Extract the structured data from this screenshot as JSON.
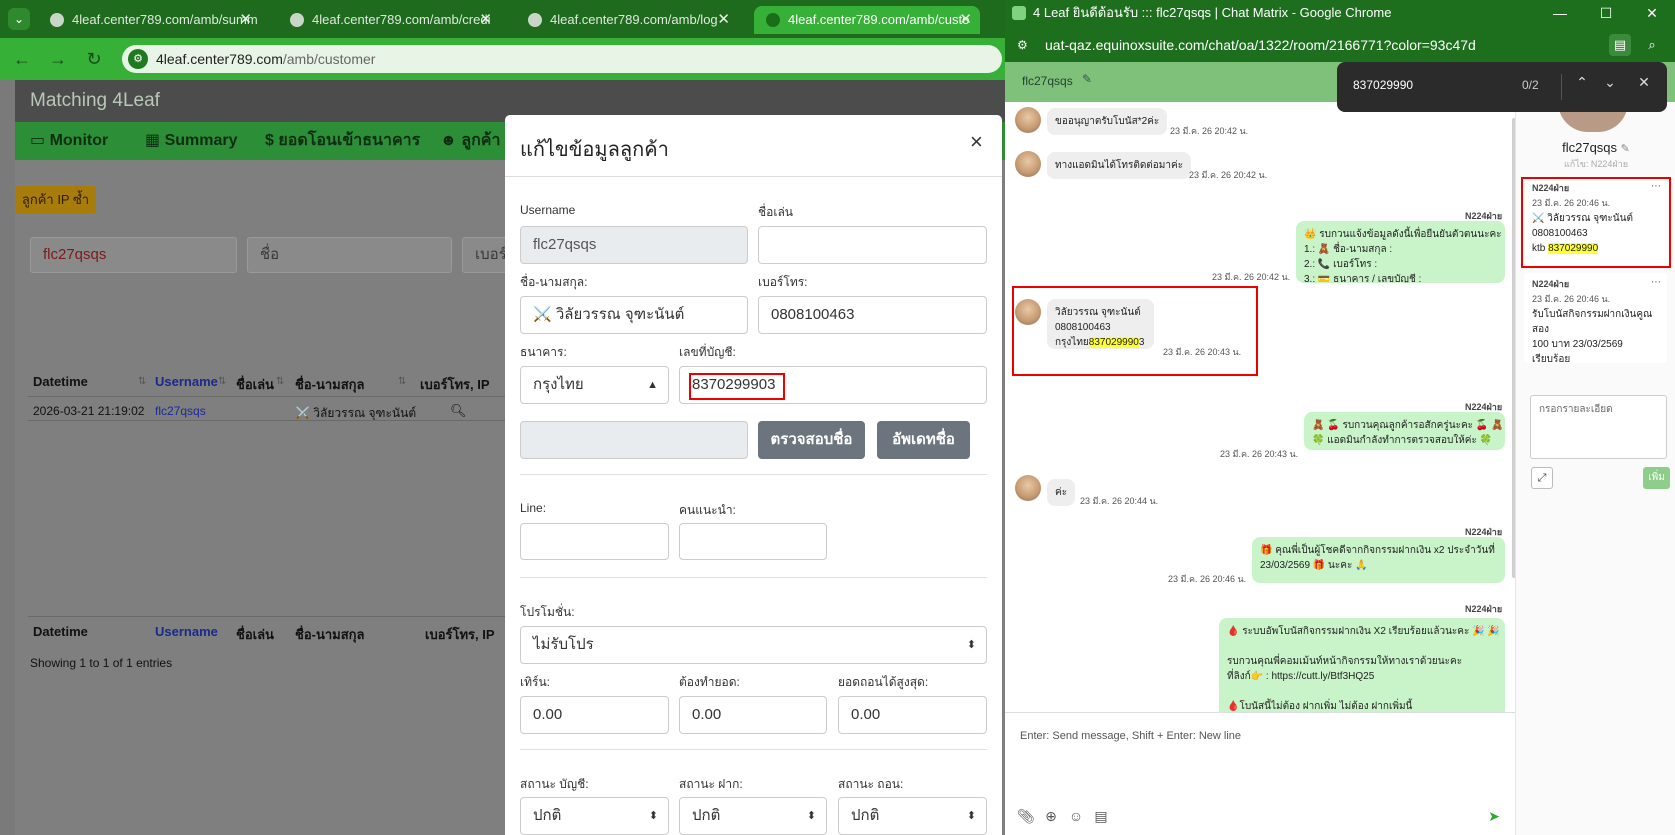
{
  "left_browser": {
    "tabs": [
      {
        "label": "4leaf.center789.com/amb/summ",
        "active": false
      },
      {
        "label": "4leaf.center789.com/amb/credi",
        "active": false
      },
      {
        "label": "4leaf.center789.com/amb/log",
        "active": false
      },
      {
        "label": "4leaf.center789.com/amb/custo",
        "active": true
      }
    ],
    "address": {
      "host": "4leaf.center789.com",
      "path": "/amb/customer"
    }
  },
  "app": {
    "title": "Matching 4Leaf",
    "nav": [
      {
        "icon": "monitor-icon",
        "label": "Monitor"
      },
      {
        "icon": "calculator-icon",
        "label": "Summary"
      },
      {
        "icon": "dollar-icon",
        "label": "ยอดโอนเข้าธนาคาร"
      },
      {
        "icon": "user-icon",
        "label": "ลูกค้า"
      }
    ],
    "dup_ip_button": "ลูกค้า IP ซ้ำ",
    "search": {
      "username": "flc27qsqs",
      "name_placeholder": "ชื่อ",
      "phone_placeholder": "เบอร์"
    },
    "table": {
      "headers": [
        "Datetime",
        "Username",
        "ชื่อเล่น",
        "ชื่อ-นามสกุล",
        "เบอร์โทร, IP"
      ],
      "rows": [
        {
          "datetime": "2026-03-21 21:19:02",
          "username": "flc27qsqs",
          "nickname": "",
          "fullname": "⚔️ วิลัยวรรณ จุฑะนันต์",
          "phone_icon": "magnifier-icon"
        }
      ],
      "footer_headers": [
        "Datetime",
        "Username",
        "ชื่อเล่น",
        "ชื่อ-นามสกุล",
        "เบอร์โทร, IP"
      ],
      "info": "Showing 1 to 1 of 1 entries"
    }
  },
  "modal": {
    "title": "แก้ไขข้อมูลลูกค้า",
    "close": "×",
    "labels": {
      "username": "Username",
      "nickname": "ชื่อเล่น",
      "fullname": "ชื่อ-นามสกุล:",
      "phone": "เบอร์โทร:",
      "bank": "ธนาคาร:",
      "account": "เลขที่บัญชี:",
      "line": "Line:",
      "referrer": "คนแนะนำ:",
      "promotion": "โปรโมชั่น:",
      "turnover": "เทิร์น:",
      "must_turn": "ต้องทำยอด:",
      "max_withdraw": "ยอดถอนได้สูงสุด:",
      "acc_status": "สถานะ บัญชี:",
      "dep_status": "สถานะ ฝาก:",
      "wd_status": "สถานะ ถอน:"
    },
    "values": {
      "username": "flc27qsqs",
      "nickname": "",
      "fullname": "⚔️ วิลัยวรรณ จุฑะนันต์",
      "phone": "0808100463",
      "bank": "กรุงไทย",
      "account": "8370299903",
      "line": "",
      "referrer": "",
      "promotion": "ไม่รับโปร",
      "turnover": "0.00",
      "must_turn": "0.00",
      "max_withdraw": "0.00",
      "acc_status": "ปกติ",
      "dep_status": "ปกติ",
      "wd_status": "ปกติ"
    },
    "buttons": {
      "verify_name": "ตรวจสอบชื่อ",
      "update_name": "อัพเดทชื่อ"
    }
  },
  "chat_window": {
    "title": "4 Leaf ยินดีต้อนรับ ::: flc27qsqs | Chat Matrix - Google Chrome",
    "url": "uat-qaz.equinoxsuite.com/chat/oa/1322/room/2166771?color=93c47d",
    "chat_name": "flc27qsqs",
    "find": {
      "query": "837029990",
      "count": "0/2"
    },
    "messages": [
      {
        "dir": "in",
        "lines": [
          "ขออนุญาตรับโบนัส*2ค่ะ"
        ],
        "time": "23 มี.ค. 26 20:42 น."
      },
      {
        "dir": "in",
        "lines": [
          "ทางแอดมินได้โทรติดต่อมาค่ะ"
        ],
        "time": "23 มี.ค. 26 20:42 น."
      },
      {
        "dir": "out",
        "sender": "N224ฝ่าย",
        "lines": [
          "👑 รบกวนแจ้งข้อมูลดังนี้เพื่อยืนยันตัวตนนะคะ 👑",
          "1.: 🧸 ชื่อ-นามสกุล :",
          "2.: 📞 เบอร์โทร :",
          "3.: 💳 ธนาคาร / เลขบัญชี :"
        ],
        "time": "23 มี.ค. 26 20:42 น."
      },
      {
        "dir": "in",
        "lines": [
          "วิลัยวรรณ จุฑะนันต์",
          "0808100463",
          "กรุงไทย",
          "837029990",
          "3"
        ],
        "time": "23 มี.ค. 26 20:43 น."
      },
      {
        "dir": "out",
        "sender": "N224ฝ่าย",
        "lines": [
          "🧸 🍒 รบกวนคุณลูกค้ารอสักครู่นะคะ 🍒 🧸",
          "🍀 แอดมินกำลังทำการตรวจสอบให้ค่ะ 🍀"
        ],
        "time": "23 มี.ค. 26 20:43 น."
      },
      {
        "dir": "in",
        "lines": [
          "ค่ะ"
        ],
        "time": "23 มี.ค. 26 20:44 น."
      },
      {
        "dir": "out",
        "sender": "N224ฝ่าย",
        "lines": [
          "🎁 คุณพี่เป็นผู้โชคดีจากกิจกรรมฝากเงิน x2 ประจำวันที่",
          "23/03/2569 🎁 นะคะ 🙏"
        ],
        "time": "23 มี.ค. 26 20:46 น."
      },
      {
        "dir": "out",
        "sender": "N224ฝ่าย",
        "lines": [
          "🩸 ระบบอัพโบนัสกิจกรรมฝากเงิน X2 เรียบร้อยแล้วนะคะ 🎉 🎉",
          "",
          "รบกวนคุณพี่คอมเม้นท์หน้ากิจกรรมให้ทางเราด้วยนะคะ",
          "ที่ลิงก์👉 : https://cutt.ly/Btf3HQ25",
          "",
          "🩸โบนัสนี้ไม่ต้อง ฝากเพิ่ม ไม่ต้อง ฝากเพิ่มนี้"
        ]
      }
    ],
    "compose_placeholder": "Enter: Send message, Shift + Enter: New line",
    "sidebar": {
      "name": "flc27qsqs",
      "sub": "แก้ไข: N224ฝ่าย",
      "notes": [
        {
          "author": "N224ฝ่าย",
          "time": "23 มี.ค. 26 20:46 น.",
          "lines": [
            "⚔️ วิลัยวรรณ จุฑะนันต์",
            "0808100463",
            "ktb",
            "837029990"
          ]
        },
        {
          "author": "N224ฝ่าย",
          "time": "23 มี.ค. 26 20:46 น.",
          "lines": [
            "รับโบนัสกิจกรรมฝากเงินคูณสอง",
            "100 บาท 23/03/2569",
            "เรียบร้อย"
          ]
        }
      ],
      "detail_placeholder": "กรอกรายละเอียด",
      "add_button": "เพิ่ม"
    }
  }
}
